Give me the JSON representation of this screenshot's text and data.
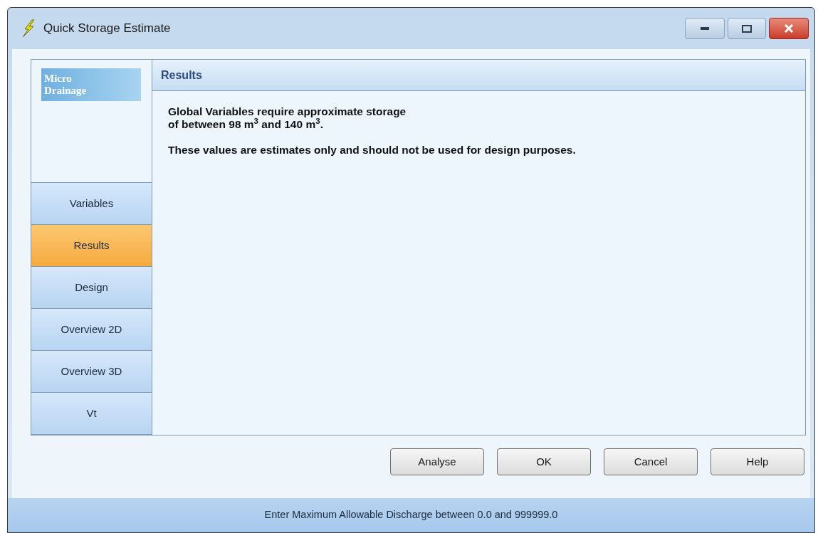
{
  "window": {
    "title": "Quick Storage Estimate"
  },
  "logo": {
    "lines": [
      "Micro",
      "Drainage"
    ]
  },
  "nav": [
    {
      "label": "Variables",
      "selected": false
    },
    {
      "label": "Results",
      "selected": true
    },
    {
      "label": "Design",
      "selected": false
    },
    {
      "label": "Overview 2D",
      "selected": false
    },
    {
      "label": "Overview 3D",
      "selected": false
    },
    {
      "label": "Vt",
      "selected": false
    }
  ],
  "panel": {
    "heading": "Results",
    "lines": [
      "Global Variables require approximate storage",
      "of between 98 m$^{3}$ and 140 m$^{3}$."
    ],
    "note": "These values are estimates only and should not be used for design purposes."
  },
  "buttons": [
    "Analyse",
    "OK",
    "Cancel",
    "Help"
  ],
  "status_bar": "Enter Maximum Allowable Discharge between 0.0 and 999999.0"
}
